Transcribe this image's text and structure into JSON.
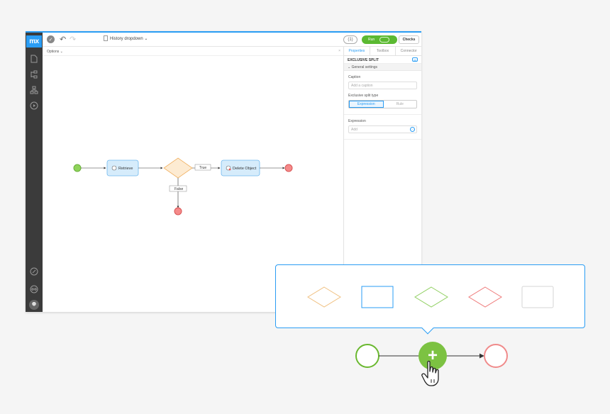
{
  "app": {
    "logo": "mx",
    "document_title": "History dropdown",
    "pill_label": "(1)",
    "run_label": "Run",
    "checks_label": "Checks"
  },
  "options": {
    "label": "Options",
    "close": "×"
  },
  "panel": {
    "tabs": [
      {
        "label": "Properties",
        "active": true
      },
      {
        "label": "Toolbox",
        "active": false
      },
      {
        "label": "Connector",
        "active": false
      }
    ],
    "title": "EXCLUSIVE SPLIT",
    "section": "General settings",
    "caption_label": "Caption",
    "caption_placeholder": "Add a caption",
    "split_type_label": "Exclusive split type",
    "split_types": [
      "Expression",
      "Rule"
    ],
    "expression_label": "Expression",
    "expression_placeholder": "Add"
  },
  "flow": {
    "retrieve_label": "Retrieve",
    "delete_label": "Delete Object",
    "true_label": "True",
    "false_label": "False"
  },
  "colors": {
    "accent": "#2a9df4",
    "start_green": "#7cc242",
    "end_red": "#f07070",
    "diamond_orange": "#f0b060",
    "activity_blue": "#d6ecfb"
  }
}
